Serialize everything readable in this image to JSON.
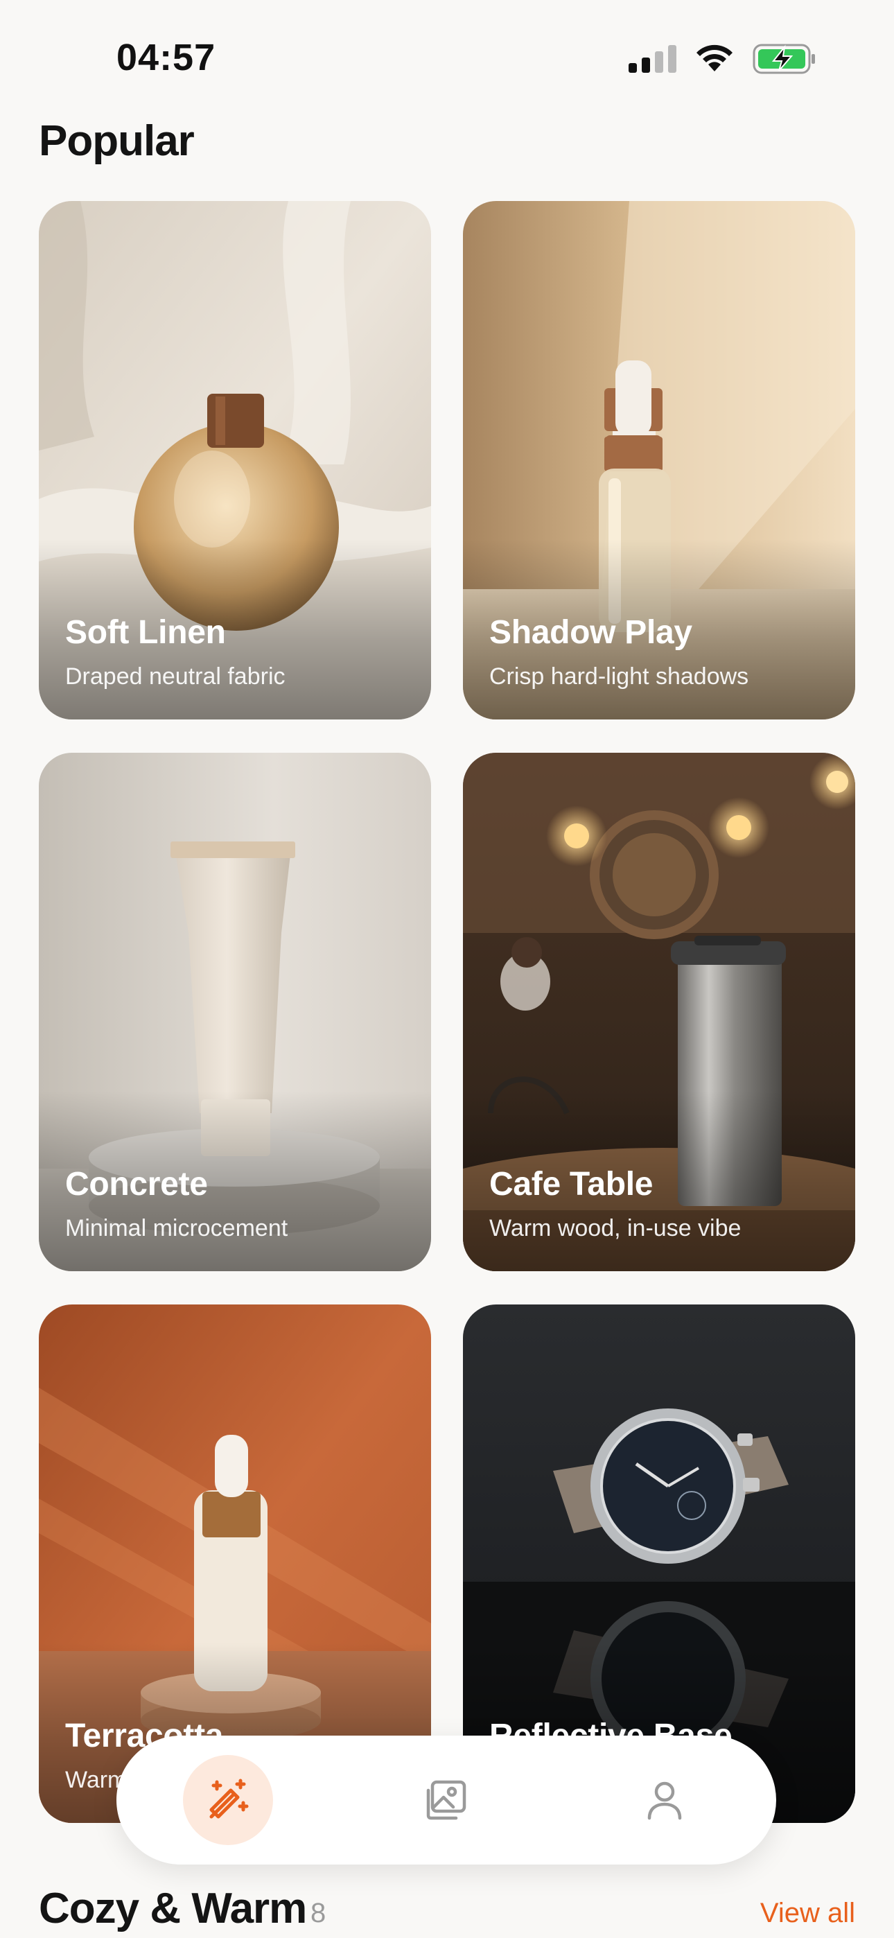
{
  "status_bar": {
    "time": "04:57",
    "icons": [
      "cellular-signal-icon",
      "wifi-icon",
      "battery-charging-icon"
    ],
    "battery_color": "#34c759"
  },
  "popular": {
    "title": "Popular",
    "cards": [
      {
        "title": "Soft Linen",
        "subtitle": "Draped neutral fabric"
      },
      {
        "title": "Shadow Play",
        "subtitle": "Crisp hard-light shadows"
      },
      {
        "title": "Concrete",
        "subtitle": "Minimal microcement"
      },
      {
        "title": "Cafe Table",
        "subtitle": "Warm wood, in-use vibe"
      },
      {
        "title": "Terracotta",
        "subtitle": "Warm"
      },
      {
        "title": "Reflective Base",
        "subtitle": ""
      }
    ]
  },
  "bottom_nav": {
    "items": [
      {
        "icon": "magic-wand-icon",
        "active": true
      },
      {
        "icon": "gallery-icon",
        "active": false
      },
      {
        "icon": "profile-icon",
        "active": false
      }
    ],
    "accent_color": "#e8601c"
  },
  "cozy_warm": {
    "title": "Cozy & Warm",
    "count": "8",
    "view_all": "View all"
  }
}
